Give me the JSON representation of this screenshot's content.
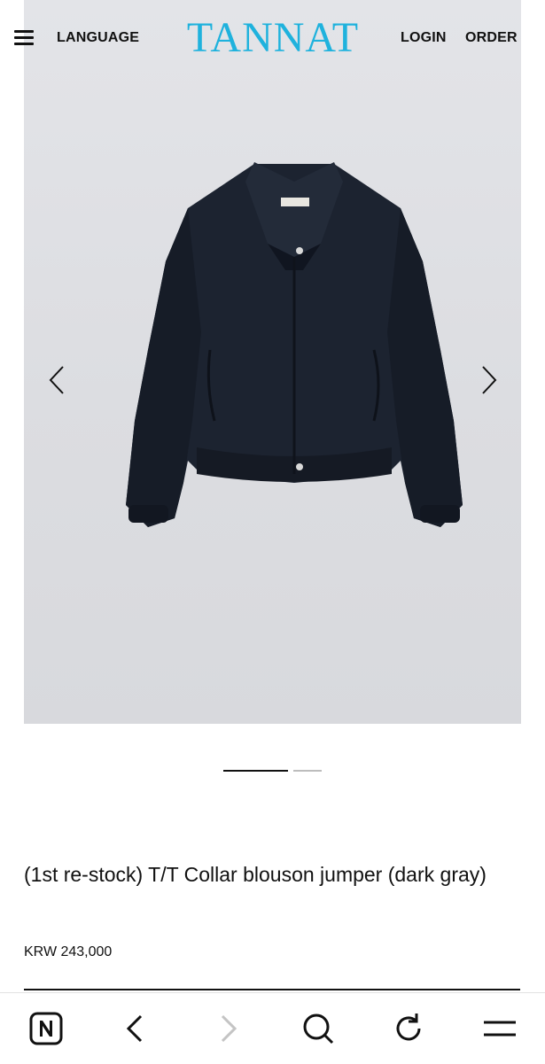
{
  "header": {
    "menu_icon": "hamburger-menu-icon",
    "language_label": "LANGUAGE",
    "logo_text": "TANNAT",
    "login_label": "LOGIN",
    "order_label": "ORDER",
    "logo_color": "#1fb2dd"
  },
  "gallery": {
    "prev_icon": "chevron-left-icon",
    "next_icon": "chevron-right-icon",
    "slide_count": 2,
    "active_slide": 1,
    "background": "#dddee2"
  },
  "product": {
    "name": "(1st re-stock) T/T Collar blouson jumper (dark gray)",
    "price": "KRW 243,000"
  },
  "browser_bar": {
    "icons": [
      "n-home-icon",
      "back-icon",
      "forward-icon",
      "search-icon",
      "reload-icon",
      "menu-icon"
    ]
  }
}
